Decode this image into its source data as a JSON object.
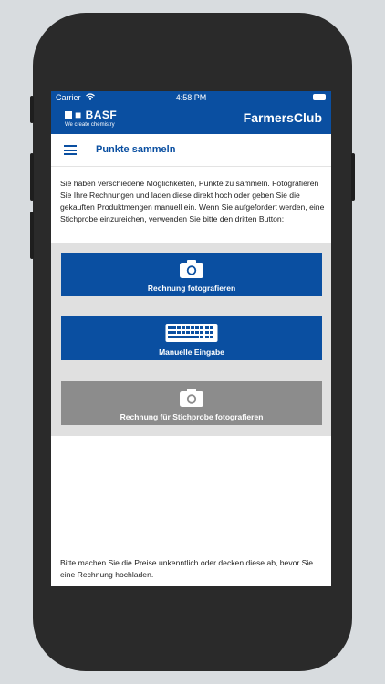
{
  "status_bar": {
    "carrier": "Carrier",
    "time": "4:58 PM"
  },
  "app_bar": {
    "logo_name": "BASF",
    "logo_tagline": "We create chemistry",
    "app_name": "FarmersClub"
  },
  "nav": {
    "title": "Punkte sammeln"
  },
  "intro_text": "Sie haben verschiedene Möglichkeiten, Punkte zu sammeln. Fotografieren Sie Ihre Rechnungen und laden diese direkt hoch oder geben Sie die gekauften Produktmengen manuell ein. Wenn Sie aufgefordert werden, eine Stichprobe einzureichen, verwenden Sie bitte den dritten Button:",
  "actions": [
    {
      "label": "Rechnung fotografieren",
      "icon": "camera-icon",
      "color": "#0a4fa1"
    },
    {
      "label": "Manuelle Eingabe",
      "icon": "keyboard-icon",
      "color": "#0a4fa1"
    },
    {
      "label": "Rechnung für Stichprobe fotografieren",
      "icon": "camera-icon",
      "color": "#8c8c8c"
    }
  ],
  "footer_text": "Bitte machen Sie die Preise unkenntlich oder decken diese ab, bevor Sie eine Rechnung hochladen.",
  "colors": {
    "brand_blue": "#0a4fa1",
    "disabled_grey": "#8c8c8c",
    "panel_grey": "#e0e0e0"
  }
}
